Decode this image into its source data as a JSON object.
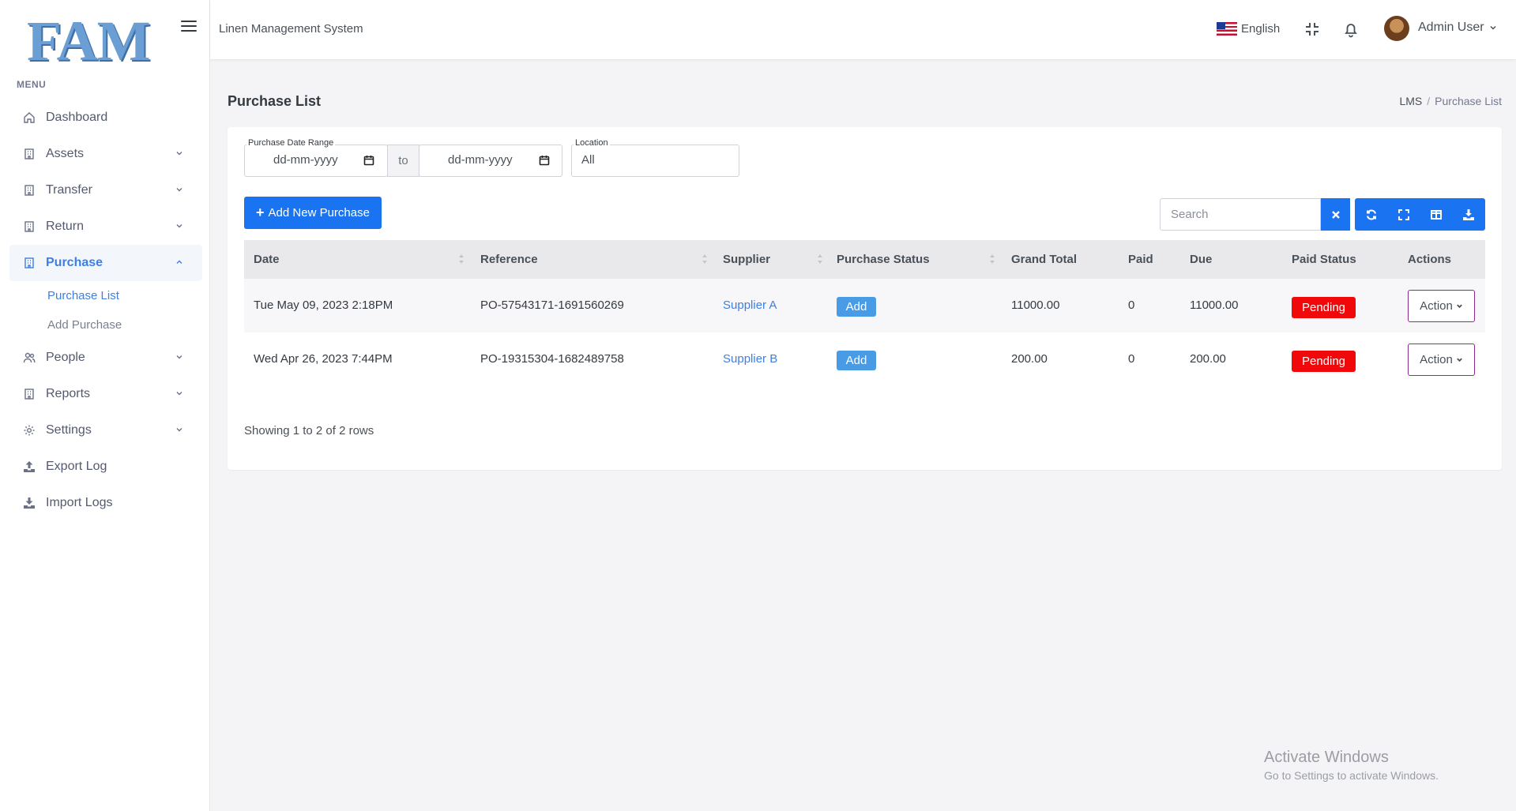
{
  "brand": {
    "logo_text": "FAM",
    "system_title": "Linen Management System"
  },
  "sidebar": {
    "menu_title": "MENU",
    "items": [
      {
        "label": "Dashboard",
        "icon": "home-icon",
        "expandable": false
      },
      {
        "label": "Assets",
        "icon": "building-icon",
        "expandable": true
      },
      {
        "label": "Transfer",
        "icon": "building-icon",
        "expandable": true
      },
      {
        "label": "Return",
        "icon": "building-icon",
        "expandable": true
      },
      {
        "label": "Purchase",
        "icon": "building-icon",
        "expandable": true,
        "active": true,
        "children": [
          {
            "label": "Purchase List",
            "active": true
          },
          {
            "label": "Add Purchase"
          }
        ]
      },
      {
        "label": "People",
        "icon": "people-icon",
        "expandable": true
      },
      {
        "label": "Reports",
        "icon": "building-icon",
        "expandable": true
      },
      {
        "label": "Settings",
        "icon": "gear-icon",
        "expandable": true
      },
      {
        "label": "Export Log",
        "icon": "upload-icon",
        "expandable": false
      },
      {
        "label": "Import Logs",
        "icon": "download-icon",
        "expandable": false
      }
    ]
  },
  "header": {
    "language": "English",
    "user_name": "Admin User",
    "icons": [
      "menu-icon",
      "flag-us-icon",
      "collapse-fullscreen-icon",
      "bell-icon",
      "avatar"
    ]
  },
  "page": {
    "title": "Purchase List",
    "breadcrumb": [
      "LMS",
      "Purchase List"
    ]
  },
  "filters": {
    "date_range_label": "Purchase Date Range",
    "from_placeholder": "dd-mm-yyyy",
    "to_label": "to",
    "to_placeholder": "dd-mm-yyyy",
    "location_label": "Location",
    "location_value": "All"
  },
  "toolbar": {
    "add_button": "Add New Purchase",
    "search_placeholder": "Search",
    "buttons": [
      "clear-icon",
      "refresh-icon",
      "fullscreen-icon",
      "columns-icon",
      "download-icon"
    ]
  },
  "table": {
    "columns": [
      "Date",
      "Reference",
      "Supplier",
      "Purchase Status",
      "Grand Total",
      "Paid",
      "Due",
      "Paid Status",
      "Actions"
    ],
    "rows": [
      {
        "date": "Tue May 09, 2023 2:18PM",
        "reference": "PO-57543171-1691560269",
        "supplier": "Supplier A",
        "purchase_status": "Add",
        "grand_total": "11000.00",
        "paid": "0",
        "due": "11000.00",
        "paid_status": "Pending",
        "action": "Action"
      },
      {
        "date": "Wed Apr 26, 2023 7:44PM",
        "reference": "PO-19315304-1682489758",
        "supplier": "Supplier B",
        "purchase_status": "Add",
        "grand_total": "200.00",
        "paid": "0",
        "due": "200.00",
        "paid_status": "Pending",
        "action": "Action"
      }
    ],
    "footer": "Showing 1 to 2 of 2 rows"
  },
  "watermark": {
    "line1": "Activate Windows",
    "line2": "Go to Settings to activate Windows."
  },
  "colors": {
    "primary": "#1a73f0",
    "accent_text": "#3f7fe0",
    "pending": "#f1080b",
    "add_badge": "#4a9be5"
  }
}
